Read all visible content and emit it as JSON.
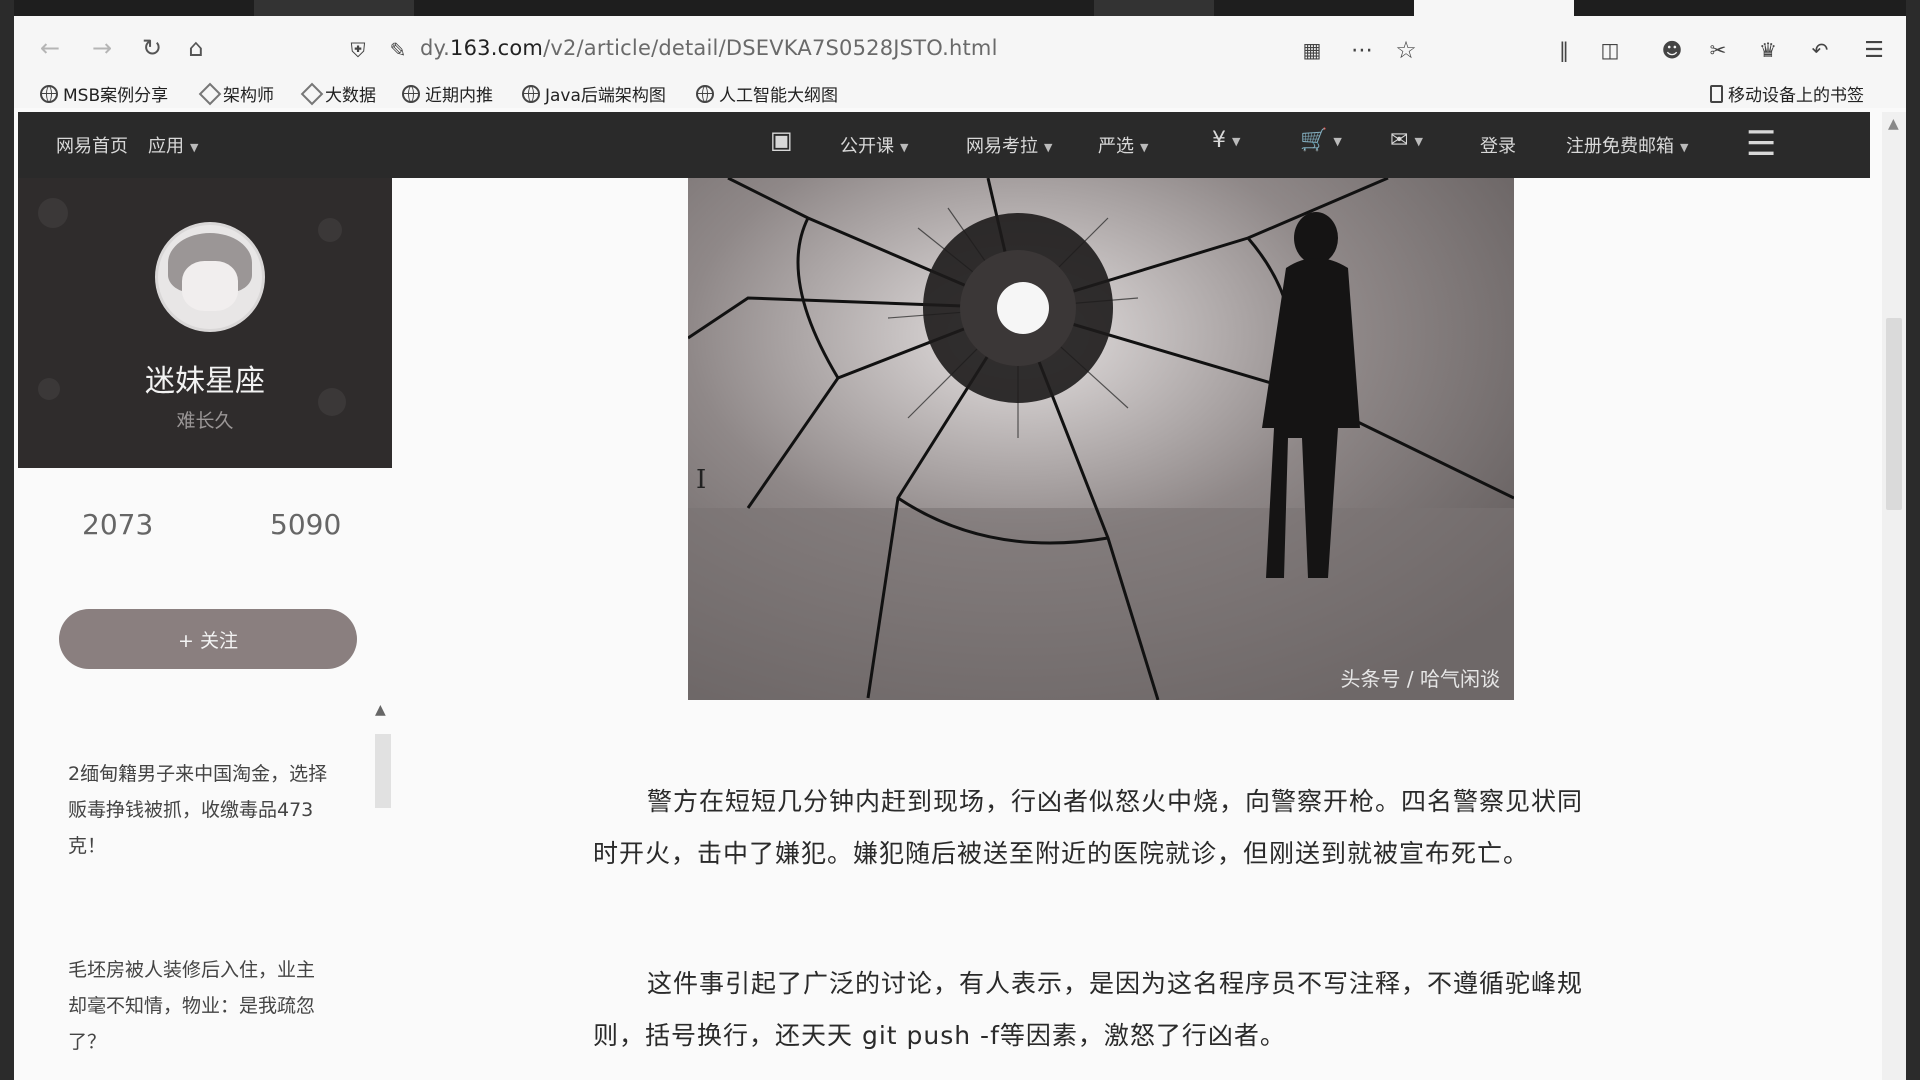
{
  "browser": {
    "url_prefix": "dy.",
    "url_domain": "163.com",
    "url_path": "/v2/article/detail/DSEVKA7S0528JSTO.html",
    "mobile_bookmarks": "移动设备上的书签"
  },
  "bookmarks": [
    {
      "label": "MSB案例分享",
      "icon": "globe-icon"
    },
    {
      "label": "架构师",
      "icon": "diamond-icon"
    },
    {
      "label": "大数据",
      "icon": "diamond-icon"
    },
    {
      "label": "近期内推",
      "icon": "globe-icon"
    },
    {
      "label": "Java后端架构图",
      "icon": "globe-icon"
    },
    {
      "label": "人工智能大纲图",
      "icon": "globe-icon"
    }
  ],
  "site_header": {
    "home": "网易首页",
    "apps": "应用",
    "open_course": "公开课",
    "kaola": "网易考拉",
    "yanxuan": "严选",
    "login": "登录",
    "register_mail": "注册免费邮箱"
  },
  "profile": {
    "name": "迷妹星座",
    "subtitle": "难长久",
    "stat1": "2073",
    "stat2": "5090",
    "follow": "+ 关注"
  },
  "sidebar_articles": [
    {
      "title": "2缅甸籍男子来中国淘金，选择贩毒挣钱被抓，收缴毒品473克！"
    },
    {
      "title": "毛坯房被人装修后入住，业主却毫不知情，物业：是我疏忽了？"
    }
  ],
  "article": {
    "image_watermark": "头条号 / 哈气闲谈",
    "paragraphs": [
      "警方在短短几分钟内赶到现场，行凶者似怒火中烧，向警察开枪。四名警察见状同时开火，击中了嫌犯。嫌犯随后被送至附近的医院就诊，但刚送到就被宣布死亡。",
      "这件事引起了广泛的讨论，有人表示，是因为这名程序员不写注释，不遵循驼峰规则，括号换行，还天天 git push -f等因素，激怒了行凶者。"
    ]
  }
}
